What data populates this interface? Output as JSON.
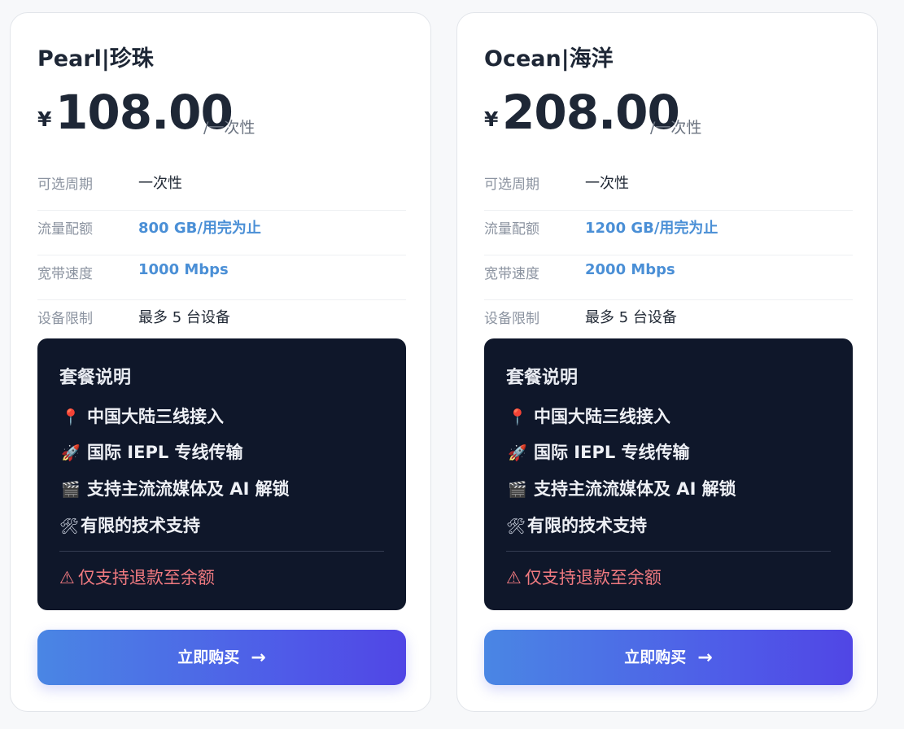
{
  "plans": [
    {
      "name": "Pearl|珍珠",
      "currency": "¥",
      "price": "108.00",
      "period": "/一次性",
      "specs": [
        {
          "label": "可选周期",
          "value": "一次性"
        },
        {
          "label": "流量配额",
          "value": "800 GB/用完为止"
        },
        {
          "label": "宽带速度",
          "value": "1000 Mbps"
        },
        {
          "label": "设备限制",
          "value": "最多 5 台设备"
        }
      ],
      "desc_title": "套餐说明",
      "features": [
        {
          "icon": "📍",
          "text": "中国大陆三线接入"
        },
        {
          "icon": "🚀",
          "text": "国际 IEPL 专线传输"
        },
        {
          "icon": "🎬",
          "text": "支持主流流媒体及 AI 解锁"
        },
        {
          "icon": "🛠",
          "text": "有限的技术支持"
        }
      ],
      "notice_icon": "⚠",
      "notice": "仅支持退款至余额",
      "buy_label": "立即购买",
      "buy_arrow": "→"
    },
    {
      "name": "Ocean|海洋",
      "currency": "¥",
      "price": "208.00",
      "period": "/一次性",
      "specs": [
        {
          "label": "可选周期",
          "value": "一次性"
        },
        {
          "label": "流量配额",
          "value": "1200 GB/用完为止"
        },
        {
          "label": "宽带速度",
          "value": "2000 Mbps"
        },
        {
          "label": "设备限制",
          "value": "最多 5 台设备"
        }
      ],
      "desc_title": "套餐说明",
      "features": [
        {
          "icon": "📍",
          "text": "中国大陆三线接入"
        },
        {
          "icon": "🚀",
          "text": "国际 IEPL 专线传输"
        },
        {
          "icon": "🎬",
          "text": "支持主流流媒体及 AI 解锁"
        },
        {
          "icon": "🛠",
          "text": "有限的技术支持"
        }
      ],
      "notice_icon": "⚠",
      "notice": "仅支持退款至余额",
      "buy_label": "立即购买",
      "buy_arrow": "→"
    }
  ],
  "colors": {
    "accent_text": "#4a8fd6",
    "button_gradient_start": "#4a86e4",
    "button_gradient_end": "#5046e5",
    "desc_background": "#0f172a",
    "notice_text": "#f07a80"
  }
}
